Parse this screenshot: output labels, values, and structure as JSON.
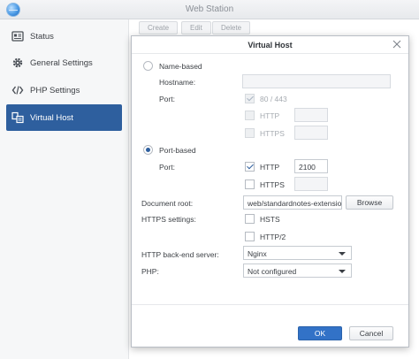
{
  "window": {
    "title": "Web Station"
  },
  "sidebar": {
    "items": [
      {
        "label": "Status",
        "icon": "status-panel-icon"
      },
      {
        "label": "General Settings",
        "icon": "gear-icon"
      },
      {
        "label": "PHP Settings",
        "icon": "code-brackets-icon"
      },
      {
        "label": "Virtual Host",
        "icon": "virtual-host-icon",
        "active": true
      }
    ]
  },
  "toolbar": {
    "create_label": "Create",
    "edit_label": "Edit",
    "delete_label": "Delete"
  },
  "dialog": {
    "title": "Virtual Host",
    "name_based": {
      "label": "Name-based",
      "selected": false,
      "hostname_label": "Hostname:",
      "hostname_value": "",
      "port_label": "Port:",
      "port_default_label": "80 / 443",
      "port_default_checked": true,
      "http_label": "HTTP",
      "https_label": "HTTPS"
    },
    "port_based": {
      "label": "Port-based",
      "selected": true,
      "port_label": "Port:",
      "http_label": "HTTP",
      "http_checked": true,
      "http_port": "2100",
      "https_label": "HTTPS",
      "https_checked": false,
      "https_port": ""
    },
    "document_root": {
      "label": "Document root:",
      "value": "web/standardnotes-extensio",
      "browse_label": "Browse"
    },
    "https_settings": {
      "label": "HTTPS settings:",
      "hsts_label": "HSTS",
      "http2_label": "HTTP/2"
    },
    "backend": {
      "label": "HTTP back-end server:",
      "value": "Nginx"
    },
    "php": {
      "label": "PHP:",
      "value": "Not configured"
    },
    "ok_label": "OK",
    "cancel_label": "Cancel"
  },
  "colors": {
    "accent": "#2e5f9e",
    "primary_button": "#3272c7"
  }
}
